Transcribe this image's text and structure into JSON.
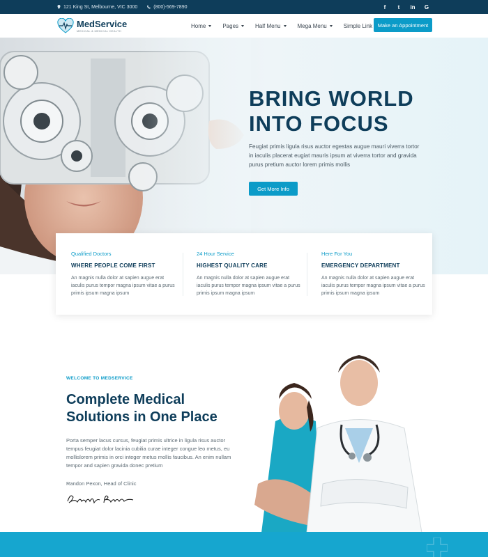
{
  "topbar": {
    "address": "121 King St, Melbourne, VIC 3000",
    "phone": "(800)-569-7890",
    "social": [
      "f",
      "t",
      "in",
      "G"
    ]
  },
  "header": {
    "brand": "MedService",
    "tagline": "MEDICAL & MEDICAL HEALTH",
    "nav": [
      {
        "label": "Home"
      },
      {
        "label": "Pages"
      },
      {
        "label": "Half Menu"
      },
      {
        "label": "Mega Menu"
      },
      {
        "label": "Simple Link"
      }
    ],
    "cta": "Make an Appointment"
  },
  "hero": {
    "title_line1": "BRING WORLD",
    "title_line2": "INTO FOCUS",
    "text": "Feugiat primis ligula risus auctor egestas augue mauri viverra tortor in iaculis placerat eugiat mauris ipsum at viverra tortor and gravida purus pretium auctor lorem primis mollis",
    "button": "Get More Info"
  },
  "features": [
    {
      "sub": "Qualified Doctors",
      "head": "WHERE PEOPLE COME FIRST",
      "body": "An magnis nulla dolor at sapien augue erat iaculis purus tempor magna ipsum vitae a purus primis ipsum magna ipsum"
    },
    {
      "sub": "24 Hour Service",
      "head": "HIGHEST QUALITY CARE",
      "body": "An magnis nulla dolor at sapien augue erat iaculis purus tempor magna ipsum vitae a purus primis ipsum magna ipsum"
    },
    {
      "sub": "Here For You",
      "head": "EMERGENCY DEPARTMENT",
      "body": "An magnis nulla dolor at sapien augue erat iaculis purus tempor magna ipsum vitae a purus primis ipsum magna ipsum"
    }
  ],
  "welcome": {
    "kicker": "WELCOME TO MEDSERVICE",
    "title": "Complete Medical Solutions in One Place",
    "text": "Porta semper lacus cursus, feugiat primis ultrice in ligula risus auctor tempus feugiat dolor lacinia cubilia curae integer congue leo metus, eu mollislorem primis in orci integer metus mollis faucibus. An enim nullam tempor and sapien gravida donec pretium",
    "author": "Randon Pexon, Head of Clinic",
    "signature": "Randon Pexon"
  },
  "colors": {
    "navy": "#0e3d5a",
    "accent": "#0b9bc8",
    "bottom_bar": "#16a6cf"
  }
}
